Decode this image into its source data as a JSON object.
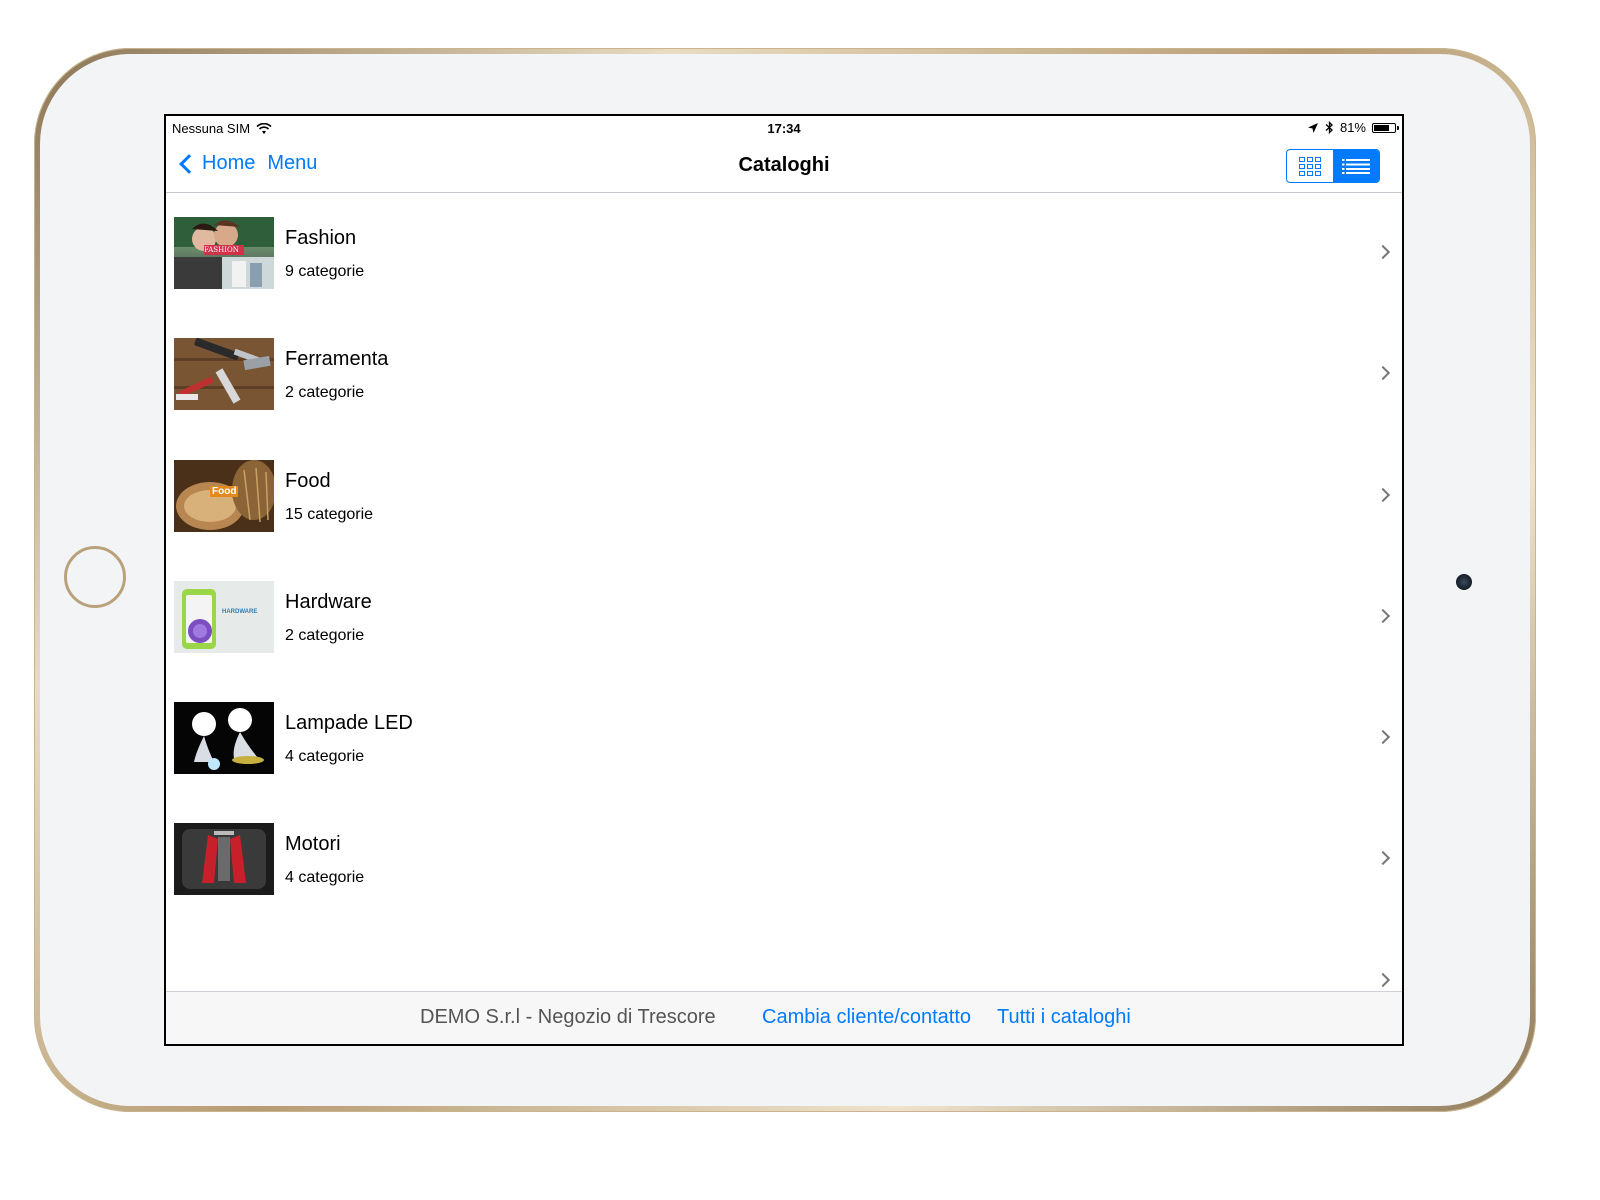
{
  "status_bar": {
    "carrier": "Nessuna SIM",
    "time": "17:34",
    "battery": "81%",
    "battery_level": 0.81
  },
  "nav": {
    "back_label": "Home",
    "menu_label": "Menu",
    "title": "Cataloghi",
    "view_modes": [
      "grid",
      "list"
    ],
    "selected_view": "list"
  },
  "catalogs": [
    {
      "name": "Fashion",
      "subtitle": "9 categorie",
      "thumb_text": "FASHION"
    },
    {
      "name": "Ferramenta",
      "subtitle": "2 categorie",
      "thumb_text": ""
    },
    {
      "name": "Food",
      "subtitle": "15 categorie",
      "thumb_text": "Food"
    },
    {
      "name": "Hardware",
      "subtitle": "2 categorie",
      "thumb_text": "HARDWARE"
    },
    {
      "name": "Lampade LED",
      "subtitle": "4 categorie",
      "thumb_text": ""
    },
    {
      "name": "Motori",
      "subtitle": "4 categorie",
      "thumb_text": ""
    }
  ],
  "bottom_bar": {
    "store": "DEMO S.r.l - Negozio di Trescore",
    "change_client": "Cambia cliente/contatto",
    "all_catalogs": "Tutti i cataloghi"
  },
  "colors": {
    "accent": "#007aff",
    "frame_gold": "#c9b48e"
  }
}
